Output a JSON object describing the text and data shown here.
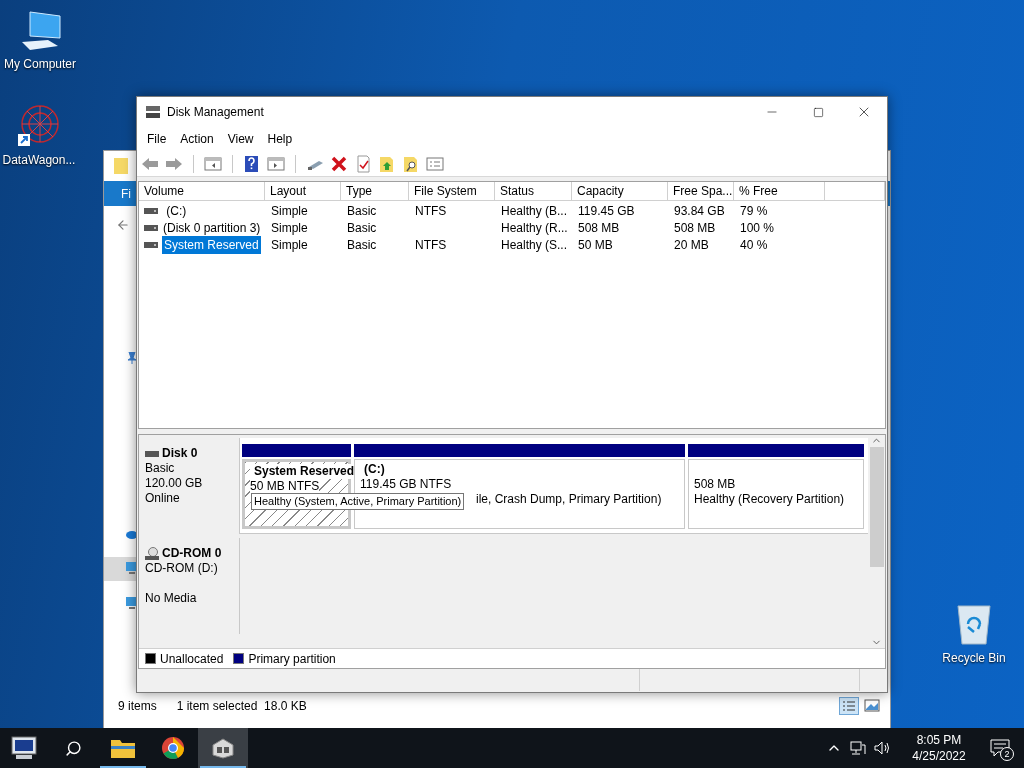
{
  "desktop_icons": [
    {
      "label": "My Computer",
      "kind": "computer"
    },
    {
      "label": "DataWagon...",
      "kind": "shortcut"
    },
    {
      "label": "Recycle Bin",
      "kind": "recycle"
    }
  ],
  "background_window": {
    "ribbon_tab": "Fi",
    "item_count": "9 items",
    "selection": "1 item selected  18.0 KB"
  },
  "window": {
    "title": "Disk Management",
    "menu": [
      "File",
      "Action",
      "View",
      "Help"
    ],
    "volume_table": {
      "columns": [
        "Volume",
        "Layout",
        "Type",
        "File System",
        "Status",
        "Capacity",
        "Free Spa...",
        "% Free"
      ],
      "rows": [
        {
          "selected": false,
          "cells": [
            " (C:)",
            "Simple",
            "Basic",
            "NTFS",
            "Healthy (B...",
            "119.45 GB",
            "93.84 GB",
            "79 %"
          ]
        },
        {
          "selected": false,
          "cells": [
            "(Disk 0 partition 3)",
            "Simple",
            "Basic",
            "",
            "Healthy (R...",
            "508 MB",
            "508 MB",
            "100 %"
          ]
        },
        {
          "selected": true,
          "cells": [
            "System Reserved",
            "Simple",
            "Basic",
            "NTFS",
            "Healthy (S...",
            "50 MB",
            "20 MB",
            "40 %"
          ]
        }
      ]
    },
    "disks": [
      {
        "kind": "disk",
        "name": "Disk 0",
        "details": [
          "Basic",
          "120.00 GB"
        ],
        "state": "Online",
        "partitions": [
          {
            "selected": true,
            "title": "System Reserved",
            "size": "50 MB NTFS"
          },
          {
            "selected": false,
            "title": "(C:)",
            "size": "119.45 GB NTFS",
            "status": "ile, Crash Dump, Primary Partition)"
          },
          {
            "selected": false,
            "size": "508 MB",
            "status": "Healthy (Recovery Partition)"
          }
        ]
      },
      {
        "kind": "cdrom",
        "name": "CD-ROM 0",
        "details": [
          "CD-ROM (D:)"
        ],
        "state": "No Media"
      }
    ],
    "tooltip": "Healthy (System, Active, Primary Partition)",
    "legend": [
      {
        "label": "Unallocated",
        "color": "#000000"
      },
      {
        "label": "Primary partition",
        "color": "#000080"
      }
    ]
  },
  "taskbar": {
    "apps": [
      {
        "kind": "explorer",
        "running": true,
        "selected": false
      },
      {
        "kind": "chrome",
        "running": false,
        "selected": false
      },
      {
        "kind": "diskmgmt",
        "running": true,
        "selected": true
      }
    ],
    "time": "8:05 PM",
    "date": "4/25/2022",
    "notifications": "2"
  }
}
